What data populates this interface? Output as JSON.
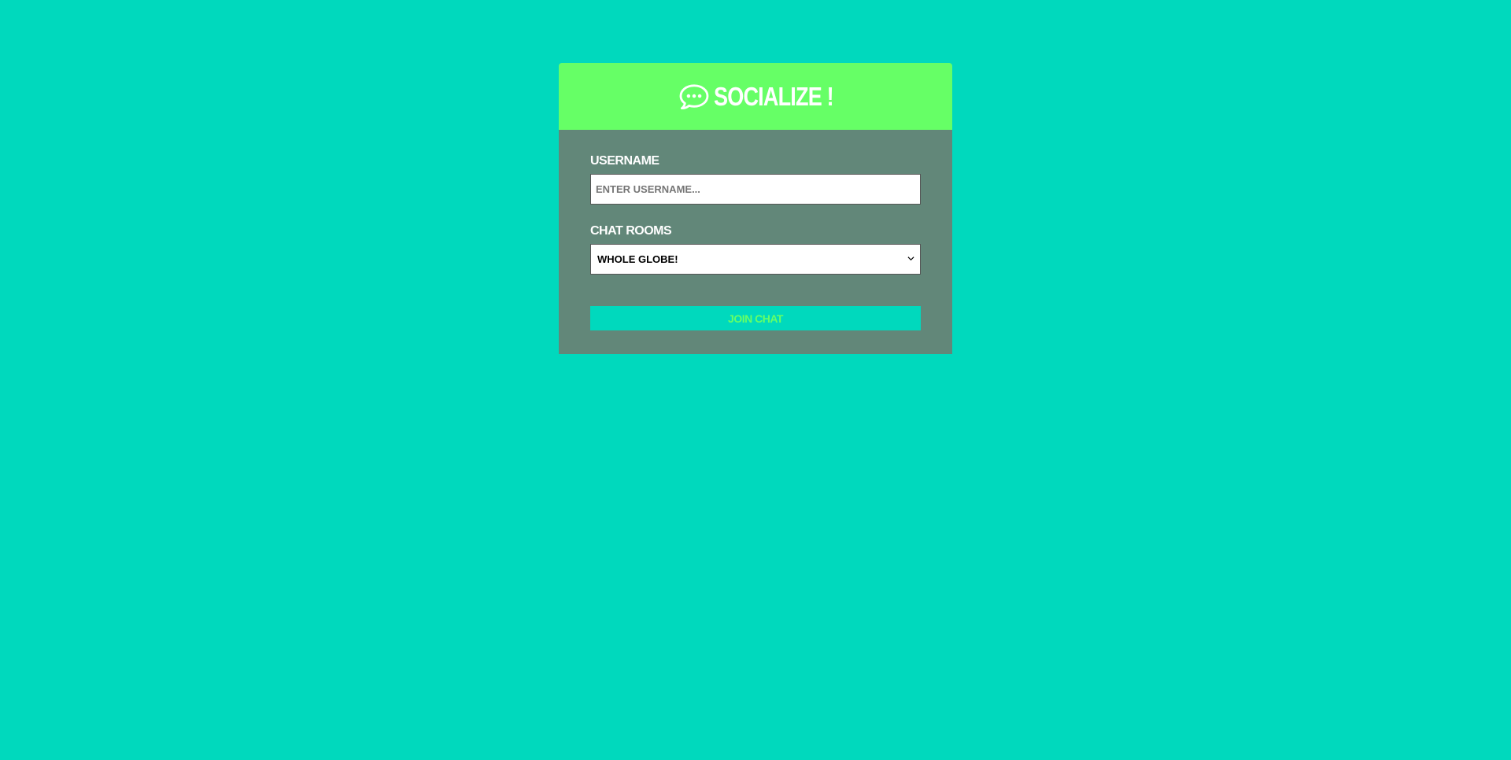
{
  "app": {
    "title": "SOCIALIZE !",
    "logo_icon": "comment-dots-icon"
  },
  "form": {
    "username": {
      "label": "USERNAME",
      "value": "",
      "placeholder": "ENTER USERNAME..."
    },
    "room": {
      "label": "CHAT ROOMS",
      "selected": "WHOLE GLOBE!"
    },
    "submit_label": "JOIN CHAT"
  },
  "colors": {
    "page_background": "#00d9bd",
    "header_background": "#66ff66",
    "body_background": "#628779",
    "button_background": "#00d9bd",
    "button_text": "#66ff66"
  }
}
